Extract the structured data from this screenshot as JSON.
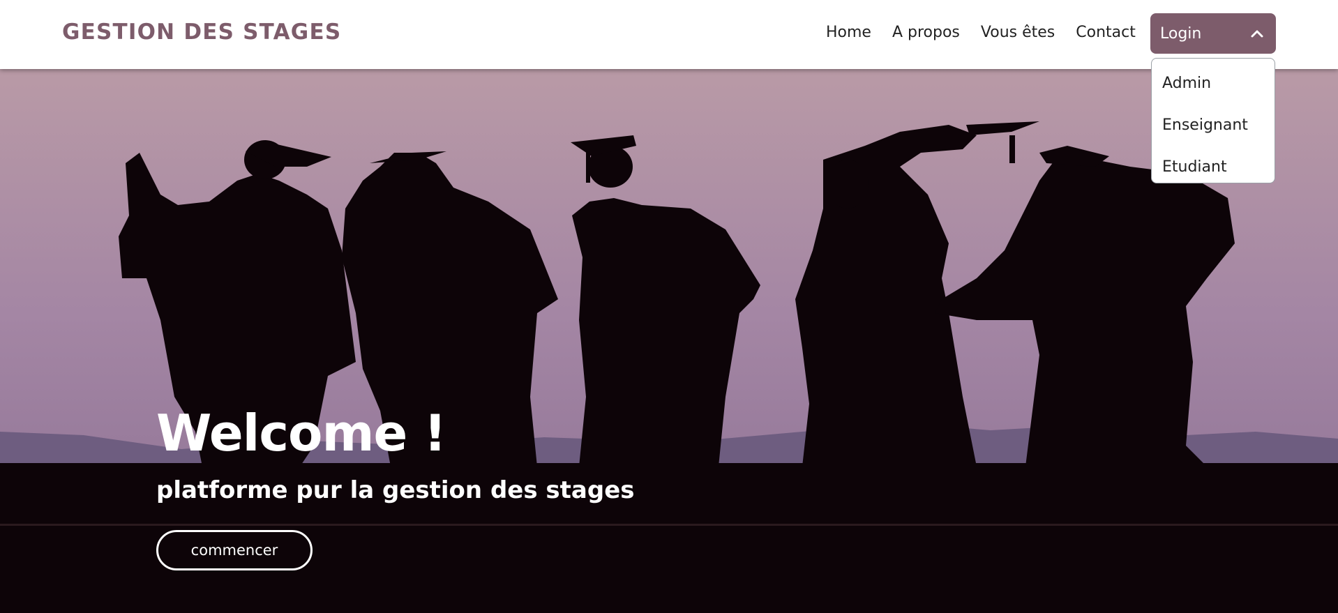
{
  "brand": "GESTION DES STAGES",
  "nav": {
    "items": [
      {
        "label": "Home"
      },
      {
        "label": "A propos"
      },
      {
        "label": "Vous êtes"
      },
      {
        "label": "Contact"
      }
    ],
    "login_label": "Login",
    "dropdown": [
      {
        "label": "Admin"
      },
      {
        "label": "Enseignant"
      },
      {
        "label": "Etudiant"
      }
    ]
  },
  "hero": {
    "title": "Welcome !",
    "subtitle": "platforme pur la gestion des stages",
    "button_label": "commencer"
  },
  "colors": {
    "brand": "#7d5c6b",
    "sky_top": "#b99aa6",
    "sky_bottom": "#8a6f92",
    "silhouette": "#0d0408"
  }
}
